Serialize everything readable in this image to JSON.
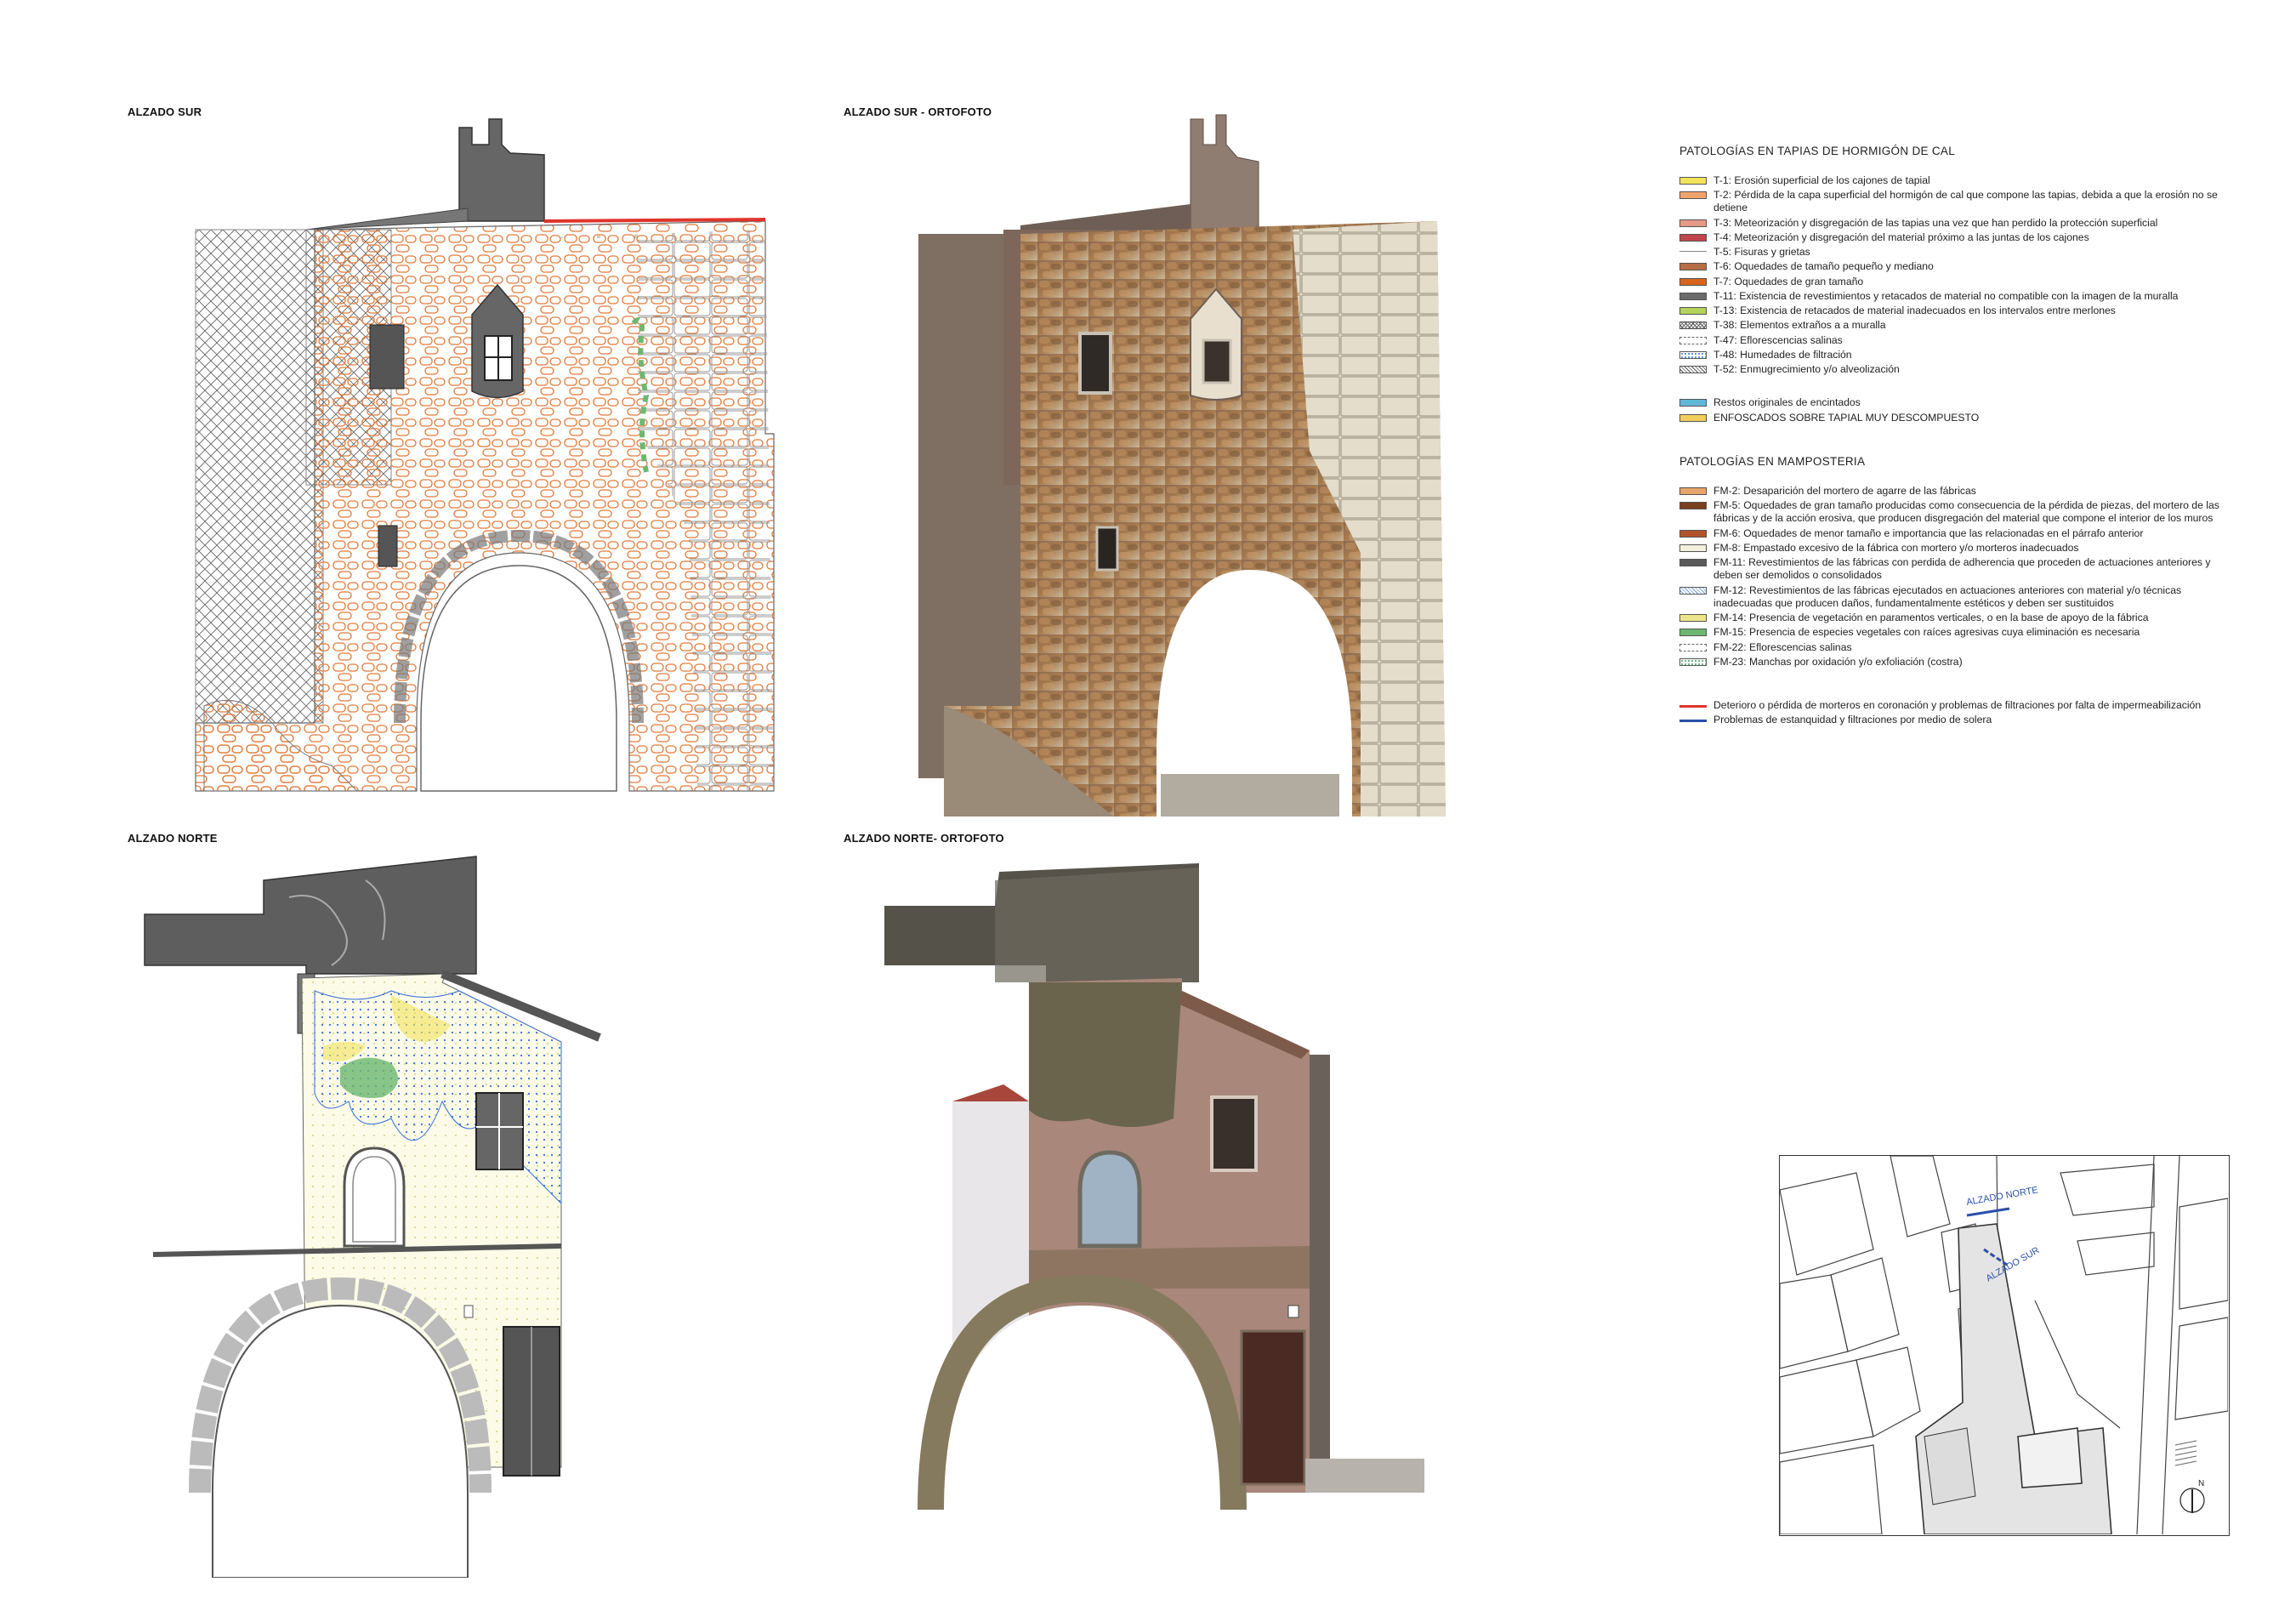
{
  "panels": {
    "south": "ALZADO SUR",
    "south_photo": "ALZADO SUR - ORTOFOTO",
    "north": "ALZADO NORTE",
    "north_photo": "ALZADO NORTE- ORTOFOTO"
  },
  "legend": {
    "tapias_title": "PATOLOGÍAS EN TAPIAS DE HORMIGÓN DE CAL",
    "tapias": [
      {
        "label": "T-1: Erosión superficial de los cajones de tapial",
        "color": "#f2e35a"
      },
      {
        "label": "T-2: Pérdida de la capa superficial del hormigón de cal que compone las tapias, debida a que la erosión no se detiene",
        "color": "#f0a36a"
      },
      {
        "label": "T-3: Meteorización y disgregación de las tapias una vez que han perdido la protección superficial",
        "color": "#e59a86"
      },
      {
        "label": "T-4: Meteorización y disgregación del material próximo a las juntas de los cajones",
        "color": "#c0454c"
      },
      {
        "label": "T-5: Fisuras y grietas",
        "color": "#ffffff"
      },
      {
        "label": "T-6: Oquedades de tamaño pequeño y mediano",
        "color": "#b86d44"
      },
      {
        "label": "T-7: Oquedades de gran tamaño",
        "color": "#d9641e"
      },
      {
        "label": "T-11: Existencia de revestimientos y retacados de material no compatible con la imagen de la muralla",
        "color": "#6b6b6b"
      },
      {
        "label": "T-13: Existencia de retacados de material inadecuados en los intervalos entre merlones",
        "color": "#b5d35a"
      },
      {
        "label": "T-38: Elementos extraños a a muralla",
        "color": "#9a9a9a"
      },
      {
        "label": "T-47: Eflorescencias salinas",
        "color": "#ffffff"
      },
      {
        "label": "T-48: Humedades de filtración",
        "color": "#9fc3ef"
      },
      {
        "label": "T-52: Enmugrecimiento y/o alveolización",
        "color": "#cccccc"
      }
    ],
    "extra": [
      {
        "label": "Restos originales de encintados",
        "color": "#5fb8d8"
      },
      {
        "label": "ENFOSCADOS SOBRE TAPIAL MUY DESCOMPUESTO",
        "color": "#f2cf5a"
      }
    ],
    "mamp_title": "PATOLOGÍAS EN MAMPOSTERIA",
    "mamp": [
      {
        "label": "FM-2: Desaparición del mortero de agarre de las fábricas",
        "color": "#e8a46a"
      },
      {
        "label": "FM-5: Oquedades de gran tamaño producidas como consecuencia de la pérdida de piezas, del mortero de las fábricas y de la acción erosiva, que producen disgregación del material que compone el interior de los muros",
        "color": "#7a3f1c"
      },
      {
        "label": "FM-6: Oquedades de menor tamaño e importancia que las relacionadas en el párrafo anterior",
        "color": "#b0552a"
      },
      {
        "label": "FM-8: Empastado excesivo de la fábrica con mortero y/o morteros inadecuados",
        "color": "#f4f0dc"
      },
      {
        "label": "FM-11: Revestimientos de las fábricas con perdida de adherencia que proceden de actuaciones anteriores y deben ser demolidos o consolidados",
        "color": "#5a5a5a"
      },
      {
        "label": "FM-12: Revestimientos de las fábricas ejecutados en actuaciones anteriores con material y/o técnicas inadecuadas que producen daños, fundamentalmente estéticos y deben ser sustituidos",
        "color": "#a8c8ec"
      },
      {
        "label": "FM-14: Presencia de vegetación en paramentos verticales, o en la base de apoyo de la fábrica",
        "color": "#ede58a"
      },
      {
        "label": "FM-15: Presencia de especies vegetales con raíces agresivas cuya eliminación es necesaria",
        "color": "#6cb86f"
      },
      {
        "label": "FM-22: Eflorescencias salinas",
        "color": "#ffffff"
      },
      {
        "label": "FM-23: Manchas por oxidación y/o exfoliación (costra)",
        "color": "#d3ead3"
      }
    ],
    "lines": [
      {
        "label": "Deterioro o pérdida de morteros en coronación y problemas de filtraciones por falta de impermeabilización",
        "color": "#e0352b"
      },
      {
        "label": "Problemas de estanquidad y filtraciones por medio de solera",
        "color": "#2b4fa8"
      }
    ]
  },
  "map": {
    "label_north": "ALZADO NORTE",
    "label_south": "ALZADO SUR",
    "north_mark": "N"
  }
}
